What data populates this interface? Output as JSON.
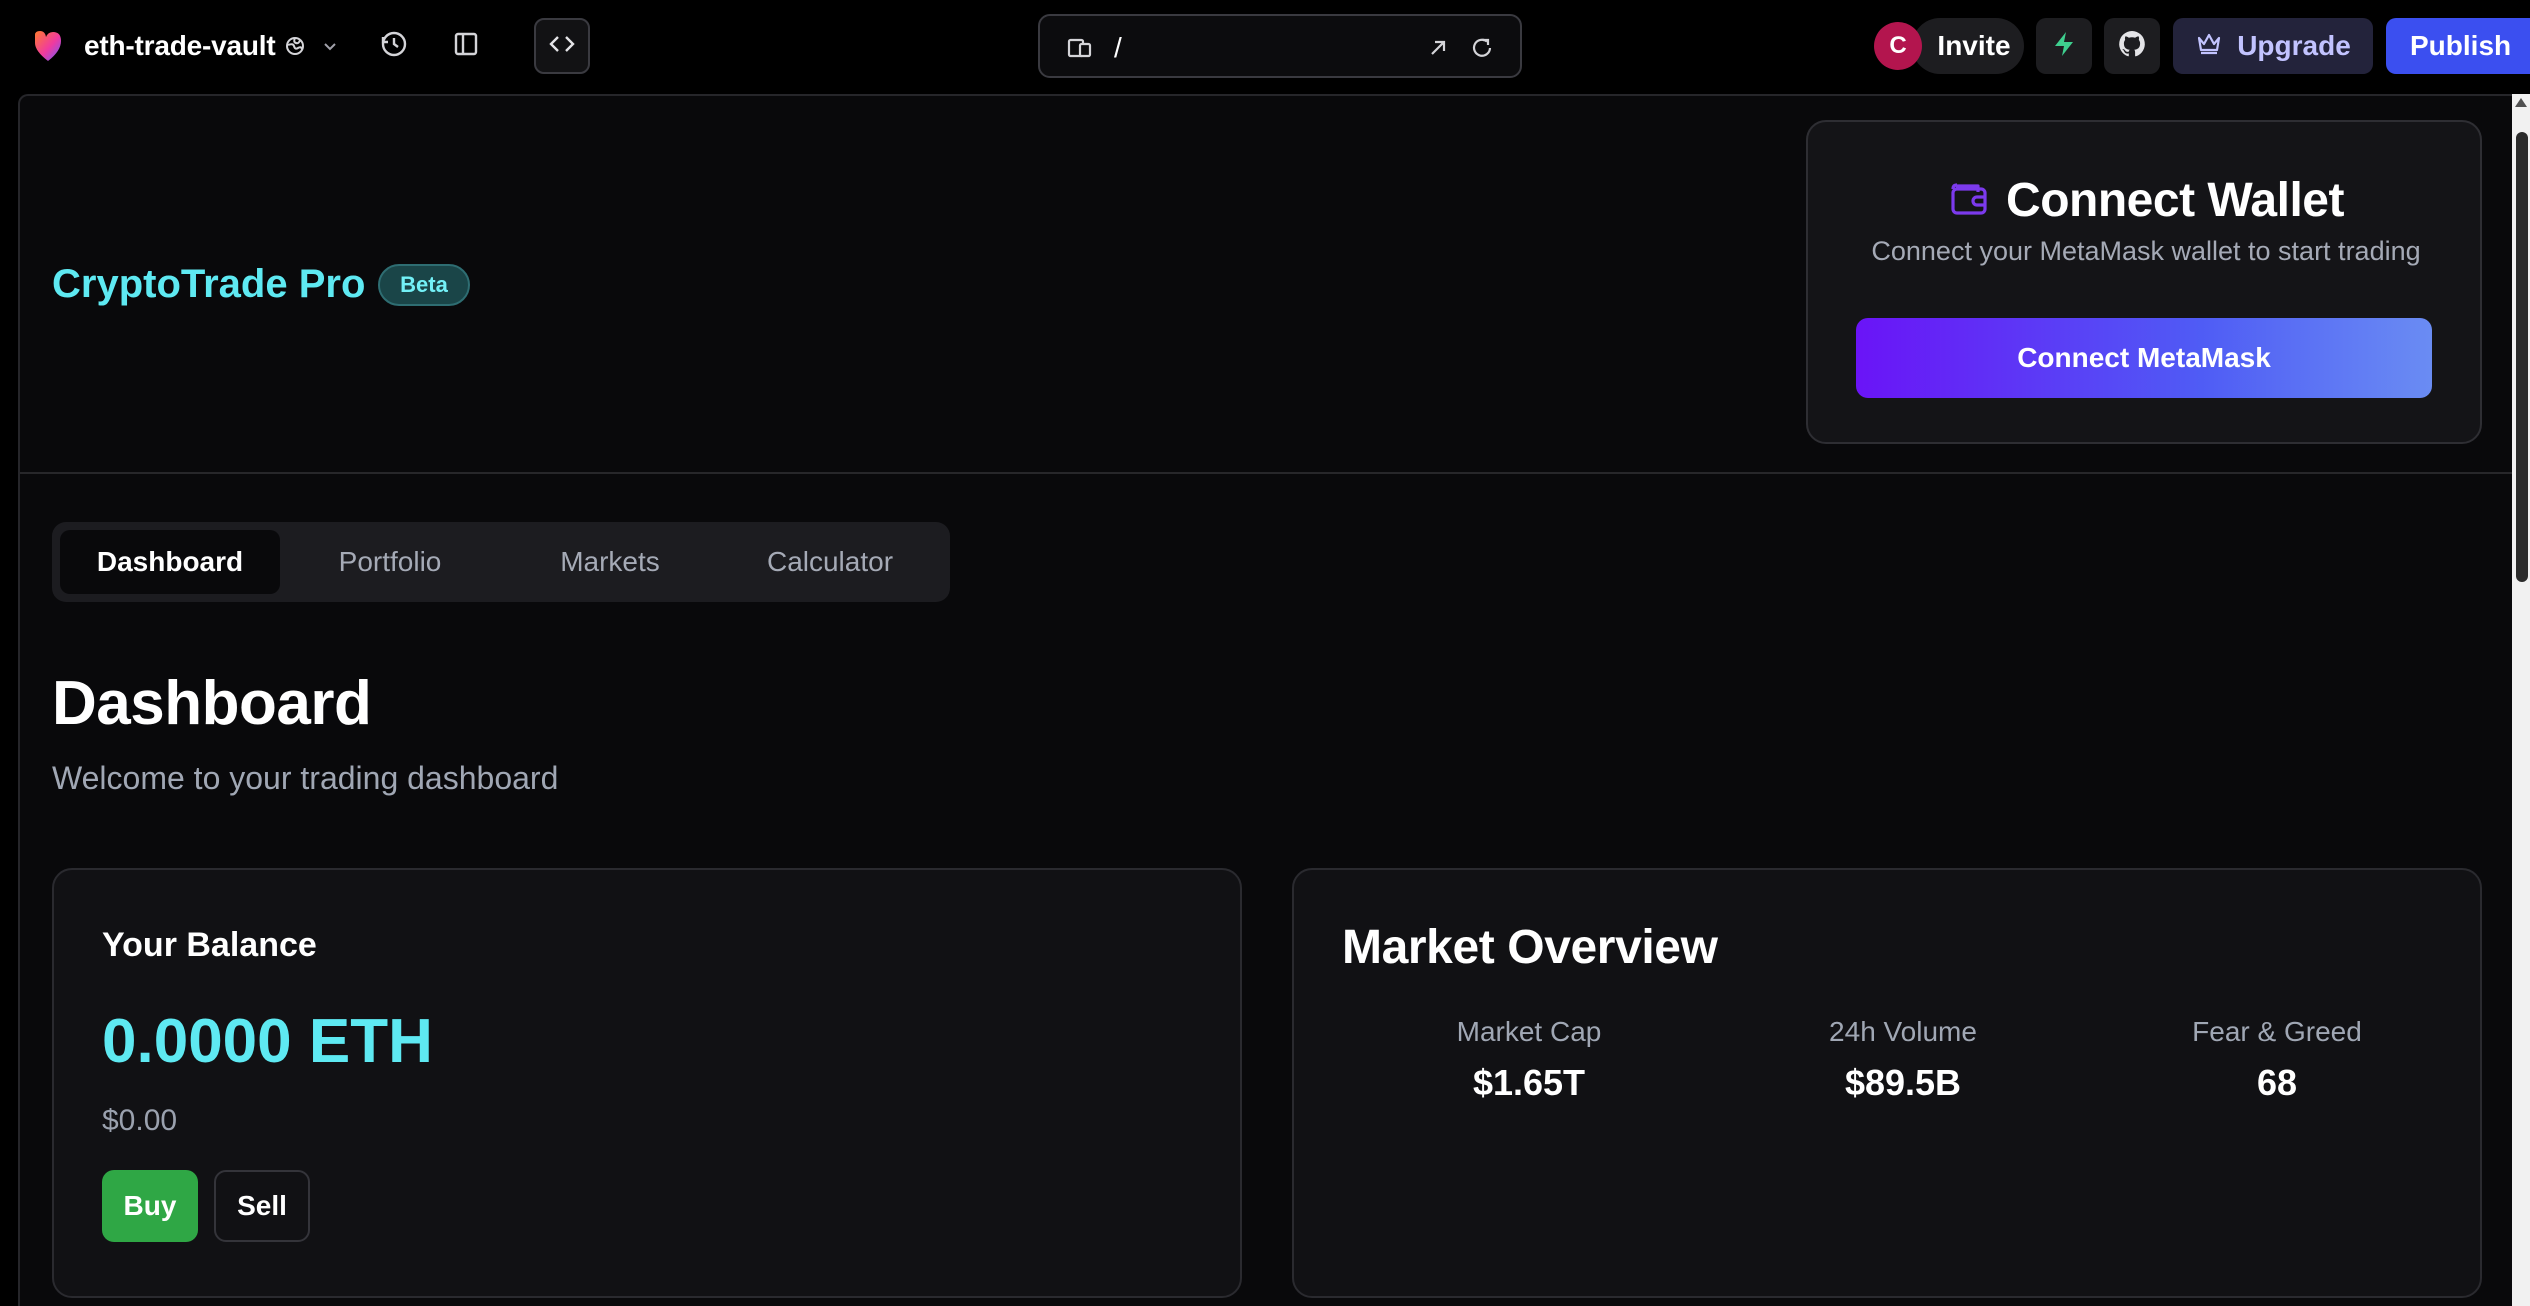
{
  "editor": {
    "project_name": "eth-trade-vault",
    "url_path": "/",
    "avatar_initial": "C",
    "invite_label": "Invite",
    "upgrade_label": "Upgrade",
    "publish_label": "Publish",
    "icons": {
      "logo": "heart-logo-icon",
      "globe": "globe-icon",
      "chevron": "chevron-down-icon",
      "history": "history-icon",
      "sidebar": "sidebar-toggle-icon",
      "code": "code-icon",
      "device": "device-preview-icon",
      "open_external": "external-link-icon",
      "refresh": "refresh-icon",
      "bolt": "supabase-bolt-icon",
      "github": "github-icon",
      "crown": "crown-icon"
    }
  },
  "app": {
    "brand": "CryptoTrade Pro",
    "badge": "Beta",
    "wallet": {
      "title": "Connect Wallet",
      "subtitle": "Connect your MetaMask wallet to start trading",
      "button": "Connect MetaMask",
      "icon": "wallet-icon"
    },
    "tabs": [
      {
        "label": "Dashboard",
        "active": true
      },
      {
        "label": "Portfolio",
        "active": false
      },
      {
        "label": "Markets",
        "active": false
      },
      {
        "label": "Calculator",
        "active": false
      }
    ],
    "page": {
      "title": "Dashboard",
      "subtitle": "Welcome to your trading dashboard"
    },
    "balance": {
      "title": "Your Balance",
      "eth": "0.0000 ETH",
      "usd": "$0.00",
      "buy_label": "Buy",
      "sell_label": "Sell"
    },
    "market": {
      "title": "Market Overview",
      "stats": [
        {
          "label": "Market Cap",
          "value": "$1.65T"
        },
        {
          "label": "24h Volume",
          "value": "$89.5B"
        },
        {
          "label": "Fear & Greed",
          "value": "68"
        }
      ]
    }
  },
  "colors": {
    "accent_cyan": "#5ee9f2",
    "publish_blue": "#3b4ff0",
    "buy_green": "#2fa745",
    "wallet_purple": "#7c3aed"
  }
}
